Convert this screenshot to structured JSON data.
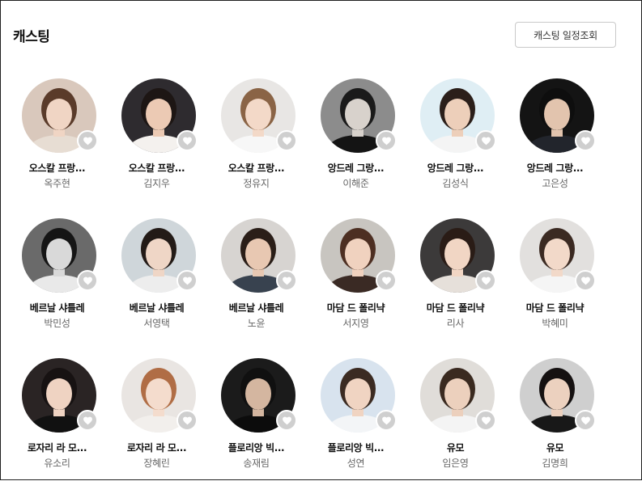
{
  "section": {
    "title": "캐스팅",
    "schedule_button": "캐스팅 일정조회"
  },
  "cast": [
    {
      "role": "오스칼 프랑...",
      "actor": "옥주현",
      "bg": "#d9c8bc",
      "hair": "#5a3b2a",
      "skin": "#f0d5c4",
      "cloth": "#e7ddd3"
    },
    {
      "role": "오스칼 프랑...",
      "actor": "김지우",
      "bg": "#2e2b2f",
      "hair": "#1d1614",
      "skin": "#eccab4",
      "cloth": "#f4f1ee"
    },
    {
      "role": "오스칼 프랑...",
      "actor": "정유지",
      "bg": "#e8e6e4",
      "hair": "#8a6446",
      "skin": "#f3d9c8",
      "cloth": "#f7f7f7"
    },
    {
      "role": "앙드레 그랑...",
      "actor": "이해준",
      "bg": "#8c8c8c",
      "hair": "#1a1a1a",
      "skin": "#d8d2cc",
      "cloth": "#141414"
    },
    {
      "role": "앙드레 그랑...",
      "actor": "김성식",
      "bg": "#dfeef4",
      "hair": "#2b1f1a",
      "skin": "#edcfba",
      "cloth": "#f4f4f4"
    },
    {
      "role": "앙드레 그랑...",
      "actor": "고은성",
      "bg": "#141414",
      "hair": "#0e0e0e",
      "skin": "#e2c4ae",
      "cloth": "#22252c"
    },
    {
      "role": "베르날 샤틀레",
      "actor": "박민성",
      "bg": "#6a6a6a",
      "hair": "#151515",
      "skin": "#d9d9d9",
      "cloth": "#e9e9e9"
    },
    {
      "role": "베르날 샤틀레",
      "actor": "서영택",
      "bg": "#cfd6da",
      "hair": "#231b17",
      "skin": "#efd6c6",
      "cloth": "#ededed"
    },
    {
      "role": "베르날 샤틀레",
      "actor": "노윤",
      "bg": "#d7d4d1",
      "hair": "#2a1e18",
      "skin": "#e8c8b2",
      "cloth": "#38424f"
    },
    {
      "role": "마담 드 폴리냑",
      "actor": "서지영",
      "bg": "#c8c5c0",
      "hair": "#4d2f22",
      "skin": "#f0d2bf",
      "cloth": "#3a2a24"
    },
    {
      "role": "마담 드 폴리냑",
      "actor": "리사",
      "bg": "#3c3a3a",
      "hair": "#2a1c16",
      "skin": "#f1d6c4",
      "cloth": "#e6e0da"
    },
    {
      "role": "마담 드 폴리냑",
      "actor": "박혜미",
      "bg": "#e2e0de",
      "hair": "#3b2a22",
      "skin": "#f2d9c9",
      "cloth": "#f5f5f5"
    },
    {
      "role": "로자리 라 모...",
      "actor": "유소리",
      "bg": "#2a2424",
      "hair": "#171212",
      "skin": "#efd3c2",
      "cloth": "#111111"
    },
    {
      "role": "로자리 라 모...",
      "actor": "장혜린",
      "bg": "#e9e5e2",
      "hair": "#b06d45",
      "skin": "#f4dccd",
      "cloth": "#f2efec"
    },
    {
      "role": "플로리앙 빅...",
      "actor": "송재림",
      "bg": "#1b1b1b",
      "hair": "#101010",
      "skin": "#d4b6a0",
      "cloth": "#0c0c0c"
    },
    {
      "role": "플로리앙 빅...",
      "actor": "성연",
      "bg": "#d8e3ee",
      "hair": "#3b2b22",
      "skin": "#f0d4c2",
      "cloth": "#f3f5f7"
    },
    {
      "role": "유모",
      "actor": "임은영",
      "bg": "#e0ddd9",
      "hair": "#3a2a20",
      "skin": "#ecd0bd",
      "cloth": "#f4f4f4"
    },
    {
      "role": "유모",
      "actor": "김명희",
      "bg": "#cfcfcf",
      "hair": "#151111",
      "skin": "#ecd1bf",
      "cloth": "#181818"
    }
  ]
}
